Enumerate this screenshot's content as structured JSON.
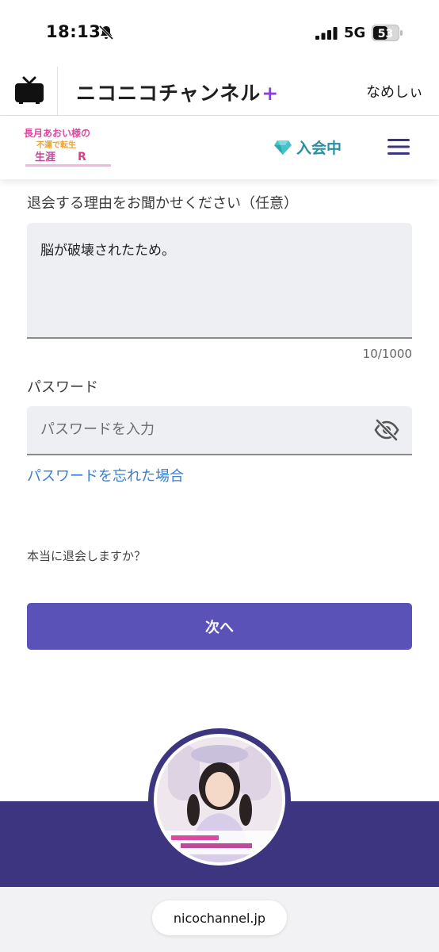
{
  "status_bar": {
    "time": "18:13",
    "network": "5G",
    "battery": "53"
  },
  "app_header": {
    "brand": "ニコニコチャンネル",
    "brand_plus": "+",
    "user_name": "なめしぃ"
  },
  "channel_header": {
    "member_status": "入会中",
    "logo_text_line1": "長月あおい様の",
    "logo_text_line2": "不運で転生",
    "logo_text_line3": "生涯",
    "logo_text_line4": "R"
  },
  "form": {
    "reason_label": "退会する理由をお聞かせください（任意）",
    "reason_value": "脳が破壊されたため。",
    "char_count": "10/1000",
    "password_label": "パスワード",
    "password_placeholder": "パスワードを入力",
    "forgot_password_link": "パスワードを忘れた場合",
    "confirm_text": "本当に退会しますか？",
    "next_button": "次へ"
  },
  "footer": {
    "url": "nicochannel.jp"
  },
  "colors": {
    "primary_button": "#5b52b8",
    "footer_band": "#3e3580",
    "link": "#3b7fd1",
    "member_badge": "#2c8fa0",
    "brand_plus": "#8b3cf0"
  }
}
